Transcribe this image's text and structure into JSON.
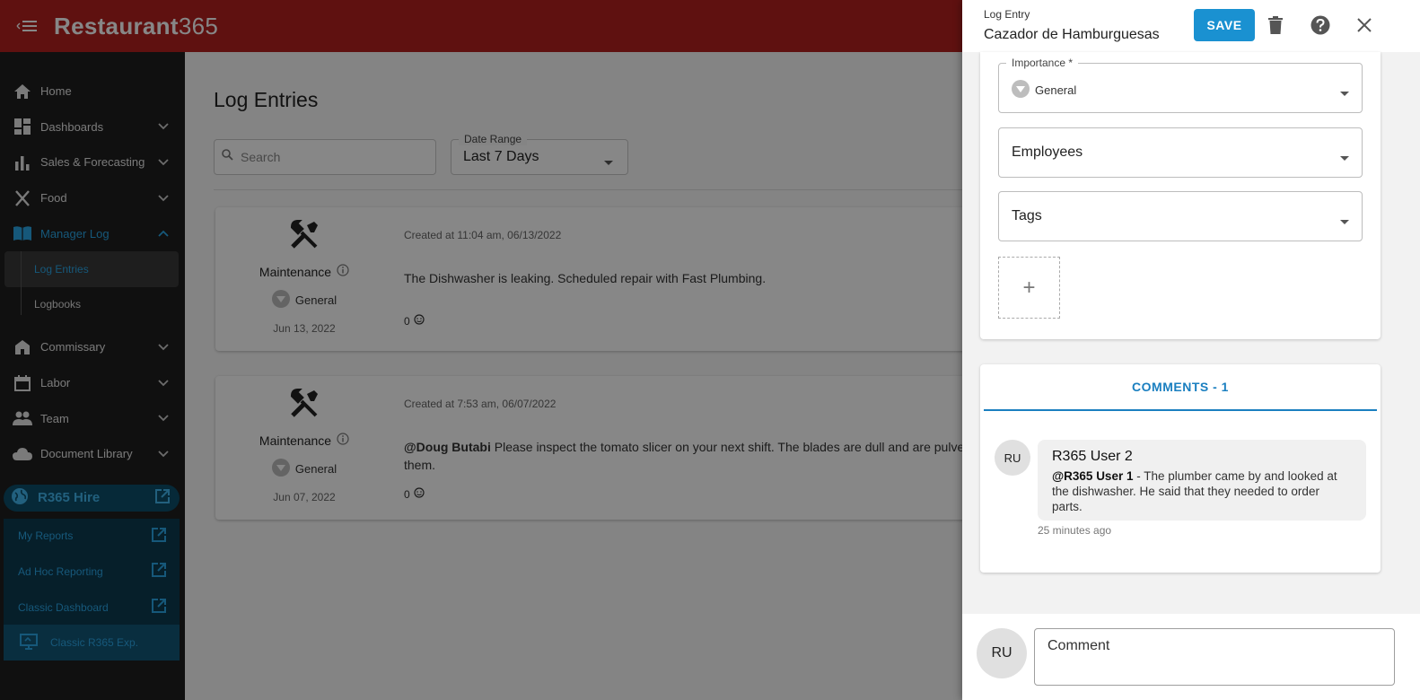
{
  "app": {
    "brand_main": "Restaurant",
    "brand_num": "365"
  },
  "sidebar": {
    "items": [
      {
        "label": "Home"
      },
      {
        "label": "Dashboards"
      },
      {
        "label": "Sales & Forecasting"
      },
      {
        "label": "Food"
      },
      {
        "label": "Manager Log"
      }
    ],
    "manager_log_sub": [
      {
        "label": "Log Entries"
      },
      {
        "label": "Logbooks"
      }
    ],
    "items2": [
      {
        "label": "Commissary"
      },
      {
        "label": "Labor"
      },
      {
        "label": "Team"
      },
      {
        "label": "Document Library"
      }
    ],
    "hire": "R365 Hire",
    "external": [
      {
        "label": "My Reports"
      },
      {
        "label": "Ad Hoc Reporting"
      },
      {
        "label": "Classic Dashboard"
      },
      {
        "label": "Classic R365 Exp."
      }
    ]
  },
  "main": {
    "title": "Log Entries",
    "search_placeholder": "Search",
    "date_range_label": "Date Range",
    "date_range_value": "Last 7 Days",
    "entries": [
      {
        "category": "Maintenance",
        "importance": "General",
        "date": "Jun 13, 2022",
        "created": "Created at 11:04 am, 06/13/2022",
        "mention": "",
        "body": "The Dishwasher is leaking. Scheduled repair with Fast Plumbing.",
        "reactions": "0"
      },
      {
        "category": "Maintenance",
        "importance": "General",
        "date": "Jun 07, 2022",
        "created": "Created at 7:53 am, 06/07/2022",
        "mention": "@Doug Butabi",
        "body": " Please inspect the tomato slicer on your next shift. The blades are dull and are pulve them.",
        "reactions": "0"
      }
    ]
  },
  "drawer": {
    "label": "Log Entry",
    "title": "Cazador de Hamburguesas",
    "save_label": "SAVE",
    "importance_label": "Importance *",
    "importance_value": "General",
    "employees_label": "Employees",
    "tags_label": "Tags",
    "add_symbol": "+",
    "comments_tab": "COMMENTS - 1",
    "comment": {
      "avatar": "RU",
      "author": "R365 User 2",
      "mention": "@R365 User 1",
      "text": " - The plumber came by and looked at the dishwasher. He said that they needed to order parts.",
      "time": "25 minutes ago"
    },
    "composer": {
      "avatar": "RU",
      "placeholder": "Comment"
    }
  },
  "colors": {
    "topbar": "#b3201f",
    "accent": "#1a91d1",
    "sidebar_active": "#2aa6e6"
  }
}
